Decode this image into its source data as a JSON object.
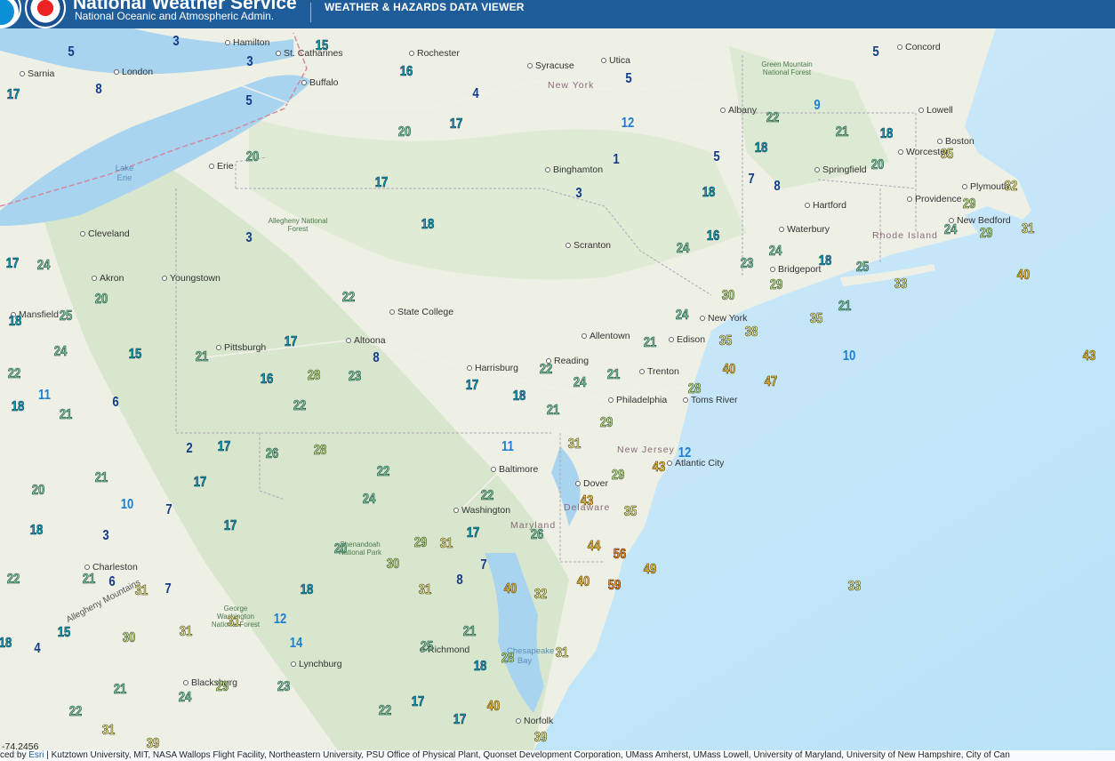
{
  "header": {
    "org_name": "National Weather Service",
    "org_sub": "National Oceanic and Atmospheric Admin.",
    "app_title": "WEATHER & HAZARDS DATA VIEWER"
  },
  "map": {
    "states": [
      "New York",
      "New Jersey",
      "Delaware",
      "Maryland",
      "Rhode Island"
    ],
    "cities": [
      "Hamilton",
      "St. Catharines",
      "Rochester",
      "Syracuse",
      "Utica",
      "Concord",
      "Sarnia",
      "London",
      "Buffalo",
      "Albany",
      "Lowell",
      "Boston",
      "Worcester",
      "Springfield",
      "Binghamton",
      "Erie",
      "Plymouth",
      "Providence",
      "Hartford",
      "Cleveland",
      "New Bedford",
      "Waterbury",
      "Scranton",
      "Akron",
      "Bridgeport",
      "Youngstown",
      "Mansfield",
      "State College",
      "New York",
      "Allentown",
      "Edison",
      "Pittsburgh",
      "Altoona",
      "Reading",
      "Harrisburg",
      "Trenton",
      "Philadelphia",
      "Toms River",
      "Atlantic City",
      "Baltimore",
      "Dover",
      "Washington",
      "Charleston",
      "Lynchburg",
      "Richmond",
      "Norfolk",
      "Blacksburg"
    ],
    "water": [
      "Lake Erie",
      "Chesapeake Bay"
    ],
    "parks": [
      "Green Mountain National Forest",
      "Allegheny National Forest",
      "Shenandoah National Park",
      "George Washington National Forest"
    ],
    "ranges": [
      "Allegheny Mountains"
    ],
    "values": [
      {
        "v": "3"
      },
      {
        "v": "15"
      },
      {
        "v": "5"
      },
      {
        "v": "3"
      },
      {
        "v": "16"
      },
      {
        "v": "5"
      },
      {
        "v": "5"
      },
      {
        "v": "17"
      },
      {
        "v": "8"
      },
      {
        "v": "5"
      },
      {
        "v": "4"
      },
      {
        "v": "12"
      },
      {
        "v": "22"
      },
      {
        "v": "9"
      },
      {
        "v": "21"
      },
      {
        "v": "18"
      },
      {
        "v": "35"
      },
      {
        "v": "20"
      },
      {
        "v": "17"
      },
      {
        "v": "18"
      },
      {
        "v": "1"
      },
      {
        "v": "5"
      },
      {
        "v": "20"
      },
      {
        "v": "7"
      },
      {
        "v": "8"
      },
      {
        "v": "20"
      },
      {
        "v": "17"
      },
      {
        "v": "3"
      },
      {
        "v": "18"
      },
      {
        "v": "32"
      },
      {
        "v": "29"
      },
      {
        "v": "18"
      },
      {
        "v": "16"
      },
      {
        "v": "24"
      },
      {
        "v": "29"
      },
      {
        "v": "31"
      },
      {
        "v": "3"
      },
      {
        "v": "24"
      },
      {
        "v": "24"
      },
      {
        "v": "17"
      },
      {
        "v": "24"
      },
      {
        "v": "23"
      },
      {
        "v": "18"
      },
      {
        "v": "25"
      },
      {
        "v": "40"
      },
      {
        "v": "20"
      },
      {
        "v": "22"
      },
      {
        "v": "30"
      },
      {
        "v": "29"
      },
      {
        "v": "33"
      },
      {
        "v": "25"
      },
      {
        "v": "18"
      },
      {
        "v": "24"
      },
      {
        "v": "21"
      },
      {
        "v": "35"
      },
      {
        "v": "17"
      },
      {
        "v": "21"
      },
      {
        "v": "35"
      },
      {
        "v": "38"
      },
      {
        "v": "24"
      },
      {
        "v": "15"
      },
      {
        "v": "21"
      },
      {
        "v": "8"
      },
      {
        "v": "22"
      },
      {
        "v": "23"
      },
      {
        "v": "10"
      },
      {
        "v": "43"
      },
      {
        "v": "40"
      },
      {
        "v": "16"
      },
      {
        "v": "28"
      },
      {
        "v": "22"
      },
      {
        "v": "21"
      },
      {
        "v": "47"
      },
      {
        "v": "11"
      },
      {
        "v": "18"
      },
      {
        "v": "17"
      },
      {
        "v": "18"
      },
      {
        "v": "24"
      },
      {
        "v": "28"
      },
      {
        "v": "6"
      },
      {
        "v": "22"
      },
      {
        "v": "21"
      },
      {
        "v": "21"
      },
      {
        "v": "29"
      },
      {
        "v": "31"
      },
      {
        "v": "2"
      },
      {
        "v": "17"
      },
      {
        "v": "26"
      },
      {
        "v": "28"
      },
      {
        "v": "11"
      },
      {
        "v": "12"
      },
      {
        "v": "21"
      },
      {
        "v": "17"
      },
      {
        "v": "22"
      },
      {
        "v": "43"
      },
      {
        "v": "29"
      },
      {
        "v": "20"
      },
      {
        "v": "22"
      },
      {
        "v": "24"
      },
      {
        "v": "10"
      },
      {
        "v": "7"
      },
      {
        "v": "43"
      },
      {
        "v": "17"
      },
      {
        "v": "35"
      },
      {
        "v": "18"
      },
      {
        "v": "3"
      },
      {
        "v": "29"
      },
      {
        "v": "31"
      },
      {
        "v": "17"
      },
      {
        "v": "26"
      },
      {
        "v": "20"
      },
      {
        "v": "44"
      },
      {
        "v": "56"
      },
      {
        "v": "49"
      },
      {
        "v": "30"
      },
      {
        "v": "7"
      },
      {
        "v": "22"
      },
      {
        "v": "21"
      },
      {
        "v": "6"
      },
      {
        "v": "31"
      },
      {
        "v": "7"
      },
      {
        "v": "18"
      },
      {
        "v": "31"
      },
      {
        "v": "8"
      },
      {
        "v": "40"
      },
      {
        "v": "32"
      },
      {
        "v": "40"
      },
      {
        "v": "59"
      },
      {
        "v": "33"
      },
      {
        "v": "12"
      },
      {
        "v": "31"
      },
      {
        "v": "15"
      },
      {
        "v": "30"
      },
      {
        "v": "31"
      },
      {
        "v": "21"
      },
      {
        "v": "18"
      },
      {
        "v": "4"
      },
      {
        "v": "14"
      },
      {
        "v": "25"
      },
      {
        "v": "28"
      },
      {
        "v": "31"
      },
      {
        "v": "18"
      },
      {
        "v": "21"
      },
      {
        "v": "29"
      },
      {
        "v": "24"
      },
      {
        "v": "23"
      },
      {
        "v": "22"
      },
      {
        "v": "17"
      },
      {
        "v": "17"
      },
      {
        "v": "40"
      },
      {
        "v": "22"
      },
      {
        "v": "31"
      },
      {
        "v": "39"
      },
      {
        "v": "39"
      }
    ]
  },
  "coordinates": "-74.2456",
  "attribution": {
    "prefix": "ced by",
    "esri": "Esri",
    "text": "| Kutztown University, MIT, NASA Wallops Flight Facility, Northeastern University, PSU Office of Physical Plant, Quonset Development Corporation, UMass Amherst, UMass Lowell, University of Maryland, University of New Hampshire, City of Can"
  }
}
